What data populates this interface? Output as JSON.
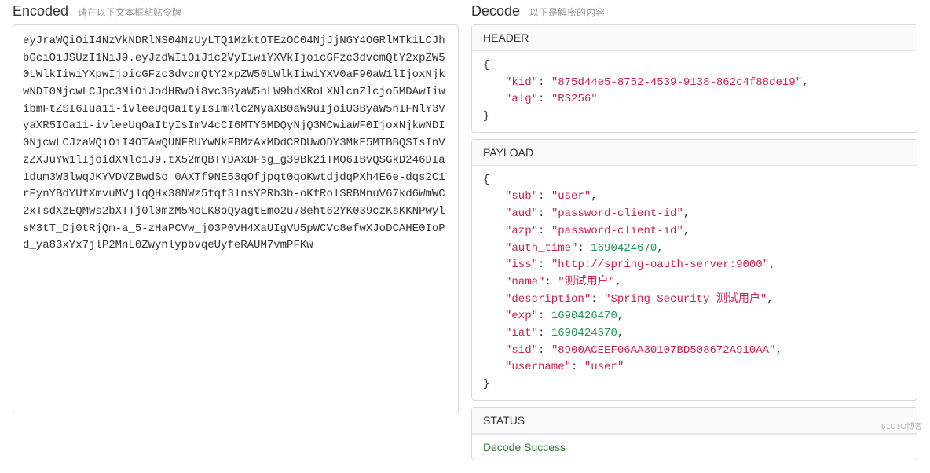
{
  "encoded": {
    "title": "Encoded",
    "hint": "请在以下文本框粘贴令牌",
    "value": "eyJraWQiOiI4NzVkNDRlNS04NzUyLTQ1MzktOTEzOC04NjJjNGY4OGRlMTkiLCJhbGciOiJSUzI1NiJ9.eyJzdWIiOiJ1c2VyIiwiYXVkIjoicGFzc3dvcmQtY2xpZW50LWlkIiwiYXpwIjoicGFzc3dvcmQtY2xpZW50LWlkIiwiYXV0aF90aW1lIjoxNjkwNDI0NjcwLCJpc3MiOiJodHRwOi8vc3ByaW5nLW9hdXRoLXNlcnZlcjo5MDAwIiwibmFtZSI6Iua1i-ivleeUqOaItyIsImRlc2NyaXB0aW9uIjoiU3ByaW5nIFNlY3VyaXR5IOa1i-ivleeUqOaItyIsImV4cCI6MTY5MDQyNjQ3MCwiaWF0IjoxNjkwNDI0NjcwLCJzaWQiOiI4OTAwQUNFRUYwNkFBMzAxMDdCRDUwODY3MkE5MTBBQSIsInVzZXJuYW1lIjoidXNlciJ9.tX52mQBTYDAxDFsg_g39Bk2iTMO6IBvQSGkD246DIa1dum3W3lwqJKYVDVZBwdSo_0AXTf9NE53qOfjpqt0qoKwtdjdqPXh4E6e-dqs2C1rFynYBdYUfXmvuMVjlqQHx38NWz5fqf3lnsYPRb3b-oKfRolSRBMnuV67kd6WmWC2xTsdXzEQMws2bXTTj0l0mzM5MoLK8oQyagtEmo2u78eht62YK039czKsKKNPwylsM3tT_Dj0tRjQm-a_5-zHaPCVw_j03P0VH4XaUIgVU5pWCVc8efwXJoDCAHE0IoPd_ya83xYx7jlP2MnL0ZwynlypbvqeUyfeRAUM7vmPFKw"
  },
  "decode": {
    "title": "Decode",
    "hint": "以下是解密的内容"
  },
  "sections": {
    "header_label": "HEADER",
    "payload_label": "PAYLOAD",
    "status_label": "STATUS",
    "status_value": "Decode Success"
  },
  "header": {
    "kid": "875d44e5-8752-4539-9138-862c4f88de19",
    "alg": "RS256"
  },
  "payload": {
    "sub": "user",
    "aud": "password-client-id",
    "azp": "password-client-id",
    "auth_time": 1690424670,
    "iss": "http://spring-oauth-server:9000",
    "name": "测试用户",
    "description": "Spring Security 测试用户",
    "exp": 1690426470,
    "iat": 1690424670,
    "sid": "8900ACEEF06AA30107BD508672A910AA",
    "username": "user"
  },
  "watermark": "51CTO博客"
}
